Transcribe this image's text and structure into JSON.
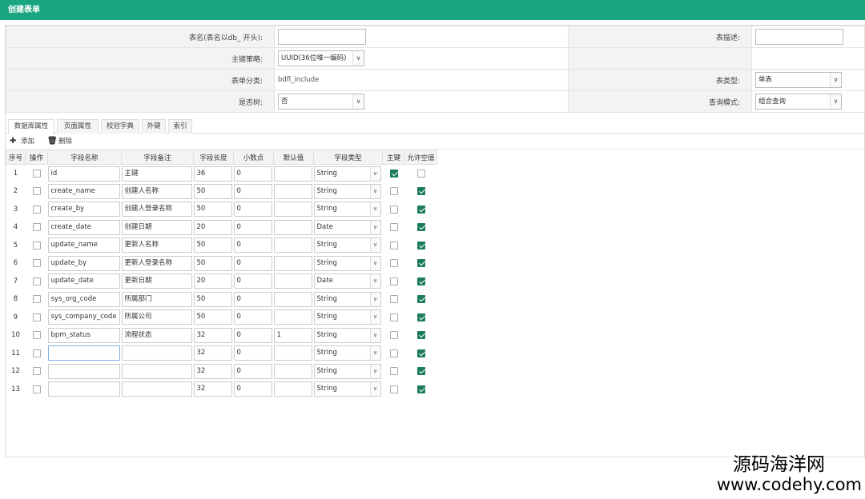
{
  "header": {
    "title": "创建表单"
  },
  "form": {
    "table_name_label": "表名(表名以db_ 开头):",
    "table_name_value": "",
    "table_desc_label": "表描述:",
    "table_desc_value": "",
    "pk_strategy_label": "主键策略:",
    "pk_strategy_value": "UUID(36位唯一编码)",
    "form_category_label": "表单分类:",
    "form_category_value": "bdfl_include",
    "table_type_label": "表类型:",
    "table_type_value": "单表",
    "is_tree_label": "是否树:",
    "is_tree_value": "否",
    "query_mode_label": "查询模式:",
    "query_mode_value": "组合查询"
  },
  "tabs": [
    {
      "label": "数据库属性",
      "active": true
    },
    {
      "label": "页面属性"
    },
    {
      "label": "校验字典"
    },
    {
      "label": "外键"
    },
    {
      "label": "索引"
    }
  ],
  "toolbar": {
    "add_label": "添加",
    "delete_label": "删除"
  },
  "columns": {
    "index": "序号",
    "op": "操作",
    "name": "字段名称",
    "remark": "字段备注",
    "length": "字段长度",
    "point": "小数点",
    "default": "默认值",
    "type": "字段类型",
    "pk": "主键",
    "nullable": "允许空值"
  },
  "rows": [
    {
      "index": "1",
      "name": "id",
      "remark": "主键",
      "length": "36",
      "point": "0",
      "default": "",
      "type": "String",
      "pk": true,
      "nullable": false
    },
    {
      "index": "2",
      "name": "create_name",
      "remark": "创建人名称",
      "length": "50",
      "point": "0",
      "default": "",
      "type": "String",
      "pk": false,
      "nullable": true
    },
    {
      "index": "3",
      "name": "create_by",
      "remark": "创建人登录名称",
      "length": "50",
      "point": "0",
      "default": "",
      "type": "String",
      "pk": false,
      "nullable": true
    },
    {
      "index": "4",
      "name": "create_date",
      "remark": "创建日期",
      "length": "20",
      "point": "0",
      "default": "",
      "type": "Date",
      "pk": false,
      "nullable": true
    },
    {
      "index": "5",
      "name": "update_name",
      "remark": "更新人名称",
      "length": "50",
      "point": "0",
      "default": "",
      "type": "String",
      "pk": false,
      "nullable": true
    },
    {
      "index": "6",
      "name": "update_by",
      "remark": "更新人登录名称",
      "length": "50",
      "point": "0",
      "default": "",
      "type": "String",
      "pk": false,
      "nullable": true
    },
    {
      "index": "7",
      "name": "update_date",
      "remark": "更新日期",
      "length": "20",
      "point": "0",
      "default": "",
      "type": "Date",
      "pk": false,
      "nullable": true
    },
    {
      "index": "8",
      "name": "sys_org_code",
      "remark": "所属部门",
      "length": "50",
      "point": "0",
      "default": "",
      "type": "String",
      "pk": false,
      "nullable": true
    },
    {
      "index": "9",
      "name": "sys_company_code",
      "remark": "所属公司",
      "length": "50",
      "point": "0",
      "default": "",
      "type": "String",
      "pk": false,
      "nullable": true
    },
    {
      "index": "10",
      "name": "bpm_status",
      "remark": "流程状态",
      "length": "32",
      "point": "0",
      "default": "1",
      "type": "String",
      "pk": false,
      "nullable": true
    },
    {
      "index": "11",
      "name": "",
      "remark": "",
      "length": "32",
      "point": "0",
      "default": "",
      "type": "String",
      "pk": false,
      "nullable": true,
      "focused": true
    },
    {
      "index": "12",
      "name": "",
      "remark": "",
      "length": "32",
      "point": "0",
      "default": "",
      "type": "String",
      "pk": false,
      "nullable": true
    },
    {
      "index": "13",
      "name": "",
      "remark": "",
      "length": "32",
      "point": "0",
      "default": "",
      "type": "String",
      "pk": false,
      "nullable": true
    }
  ],
  "watermark": {
    "line1": "源码海洋网",
    "line2": "www.codehy.com"
  },
  "colors": {
    "header_bg": "#1aa581",
    "checkbox_checked": "#1b7b5d"
  }
}
